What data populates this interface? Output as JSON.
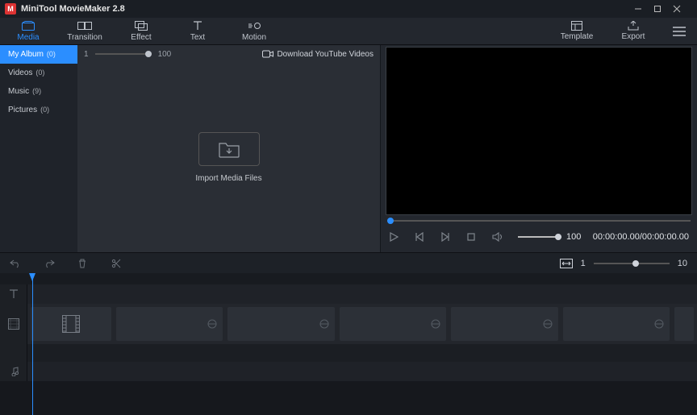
{
  "app": {
    "title": "MiniTool MovieMaker 2.8",
    "icon_glyph": "M"
  },
  "window": {
    "min": "min",
    "max": "max",
    "close": "close"
  },
  "tabs": {
    "media": "Media",
    "transition": "Transition",
    "effect": "Effect",
    "text": "Text",
    "motion": "Motion",
    "template": "Template",
    "export": "Export"
  },
  "sidebar": {
    "items": [
      {
        "label": "My Album",
        "count": "(0)"
      },
      {
        "label": "Videos",
        "count": "(0)"
      },
      {
        "label": "Music",
        "count": "(9)"
      },
      {
        "label": "Pictures",
        "count": "(0)"
      }
    ]
  },
  "mediatop": {
    "thumb_min": "1",
    "thumb_max": "100",
    "download_label": "Download YouTube Videos"
  },
  "import": {
    "label": "Import Media Files"
  },
  "preview": {
    "volume_value": "100",
    "timecode": "00:00:00.00/00:00:00.00"
  },
  "timeline": {
    "zoom_min": "1",
    "zoom_max": "10"
  }
}
